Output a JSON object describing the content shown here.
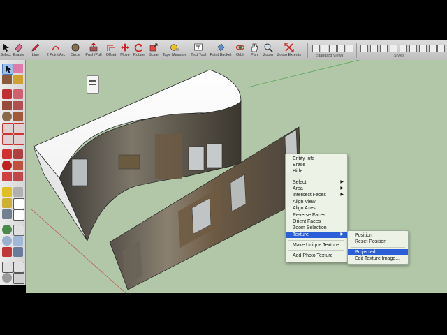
{
  "toolbar": {
    "tools": [
      {
        "label": "Select",
        "icon": "arrow-icon"
      },
      {
        "label": "Eraser",
        "icon": "eraser-icon"
      },
      {
        "label": "Line",
        "icon": "pencil-icon"
      },
      {
        "label": "2 Point Arc",
        "icon": "arc-icon"
      },
      {
        "label": "Circle",
        "icon": "circle-icon"
      },
      {
        "label": "Push/Pull",
        "icon": "pushpull-icon"
      },
      {
        "label": "Offset",
        "icon": "offset-icon"
      },
      {
        "label": "Move",
        "icon": "move-icon"
      },
      {
        "label": "Rotate",
        "icon": "rotate-icon"
      },
      {
        "label": "Scale",
        "icon": "scale-icon"
      },
      {
        "label": "Tape Measure",
        "icon": "tape-measure-icon"
      },
      {
        "label": "Text Tool",
        "icon": "text-icon"
      },
      {
        "label": "Paint Bucket",
        "icon": "paint-bucket-icon"
      },
      {
        "label": "Orbit",
        "icon": "orbit-icon"
      },
      {
        "label": "Pan",
        "icon": "pan-icon"
      },
      {
        "label": "Zoom",
        "icon": "zoom-icon"
      },
      {
        "label": "Zoom Extents",
        "icon": "zoom-extents-icon"
      }
    ],
    "standard_views_label": "Standard Views",
    "styles_label": "Styles"
  },
  "context_menu": {
    "items": [
      {
        "label": "Entity Info",
        "submenu": false
      },
      {
        "label": "Erase",
        "submenu": false
      },
      {
        "label": "Hide",
        "submenu": false
      },
      {
        "label": "Select",
        "submenu": true
      },
      {
        "label": "Area",
        "submenu": true
      },
      {
        "label": "Intersect Faces",
        "submenu": true
      },
      {
        "label": "Align View",
        "submenu": false
      },
      {
        "label": "Align Axes",
        "submenu": false
      },
      {
        "label": "Reverse Faces",
        "submenu": false
      },
      {
        "label": "Orient Faces",
        "submenu": false
      },
      {
        "label": "Zoom Selection",
        "submenu": false
      },
      {
        "label": "Texture",
        "submenu": true,
        "highlighted": true
      },
      {
        "label": "Make Unique Texture",
        "submenu": false
      },
      {
        "label": "Add Photo Texture",
        "submenu": false
      }
    ]
  },
  "texture_submenu": {
    "items": [
      {
        "label": "Position"
      },
      {
        "label": "Reset Position"
      },
      {
        "label": "Projected",
        "highlighted": true
      },
      {
        "label": "Edit Texture Image..."
      }
    ]
  },
  "colors": {
    "viewport_green": "#b2c7a8",
    "highlight_blue": "#2a5fd8",
    "menu_bg": "#eef4e8"
  }
}
